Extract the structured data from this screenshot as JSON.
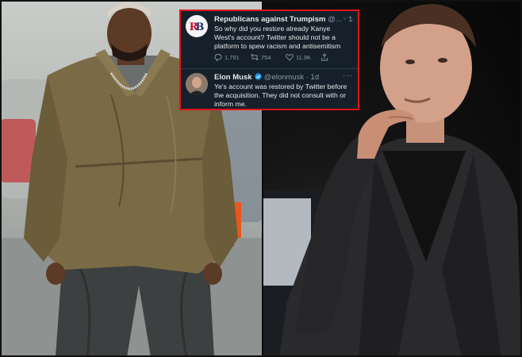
{
  "tweet1": {
    "avatar_text": "RB",
    "name": "Republicans against Trumpism",
    "handle": "@...",
    "time": "· 1d",
    "more": "···",
    "body": "So why did you restore already Kanye West's account? Twitter should not be a platform to spew racism and antisemitism",
    "replies": "1,791",
    "retweets": "754",
    "likes": "11.9K"
  },
  "tweet2": {
    "name": "Elon Musk",
    "handle": "@elonmusk",
    "time": "· 1d",
    "more": "···",
    "body": "Ye's account was restored by Twitter before the acquisition. They did not consult with or inform me."
  },
  "colors": {
    "tweet_bg": "#15202b",
    "highlight_border": "#e0131b",
    "verified_blue": "#1d9bf0"
  }
}
